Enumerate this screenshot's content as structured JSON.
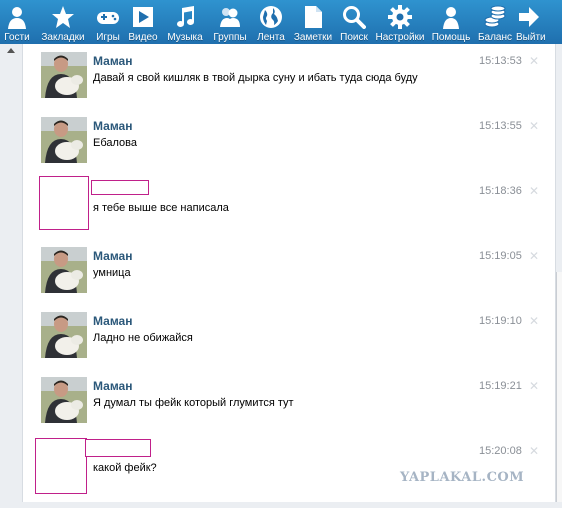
{
  "toolbar": {
    "items": [
      {
        "label": "Гости",
        "icon": "person-icon"
      },
      {
        "label": "Закладки",
        "icon": "star-icon"
      },
      {
        "label": "Игры",
        "icon": "gamepad-icon"
      },
      {
        "label": "Видео",
        "icon": "play-icon"
      },
      {
        "label": "Музыка",
        "icon": "music-note-icon"
      },
      {
        "label": "Группы",
        "icon": "group-icon"
      },
      {
        "label": "Лента",
        "icon": "globe-icon"
      },
      {
        "label": "Заметки",
        "icon": "document-icon"
      },
      {
        "label": "Поиск",
        "icon": "search-icon"
      },
      {
        "label": "Настройки",
        "icon": "gear-icon"
      },
      {
        "label": "Помощь",
        "icon": "help-person-icon"
      },
      {
        "label": "Баланс",
        "icon": "coins-icon"
      },
      {
        "label": "Выйти",
        "icon": "exit-arrow-icon"
      }
    ],
    "bg_color": "#1f6fae"
  },
  "messages": [
    {
      "author": "Маман",
      "time": "15:13:53",
      "text": "Давай я свой кишляк в твой дырка суну и ибать туда сюда буду"
    },
    {
      "author": "Маман",
      "time": "15:13:55",
      "text": "Ебалова"
    },
    {
      "author": "",
      "time": "15:18:36",
      "text": "я тебе выше все написала"
    },
    {
      "author": "Маман",
      "time": "15:19:05",
      "text": "умница"
    },
    {
      "author": "Маман",
      "time": "15:19:10",
      "text": "Ладно не обижайся"
    },
    {
      "author": "Маман",
      "time": "15:19:21",
      "text": "Я думал ты фейк который глумится тут"
    },
    {
      "author": "",
      "time": "15:20:08",
      "text": "какой фейк?"
    }
  ],
  "watermark": "YAPLAKAL.COM",
  "colors": {
    "author_name": "#2b587a",
    "redaction_border": "#c0208a",
    "timestamp": "#8a8f96"
  }
}
